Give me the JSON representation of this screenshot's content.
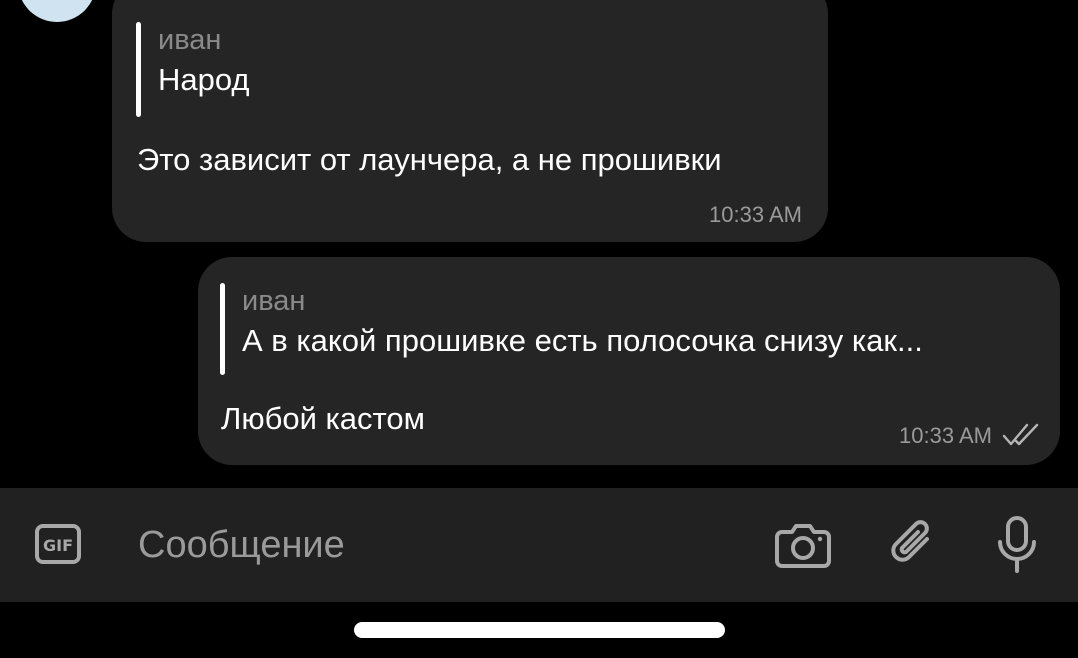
{
  "messages": [
    {
      "direction": "incoming",
      "reply": {
        "author": "иван",
        "text": "Народ"
      },
      "text": "Это зависит от лаунчера, а не прошивки",
      "time": "10:33 AM"
    },
    {
      "direction": "outgoing",
      "reply": {
        "author": "иван",
        "text": "А в какой прошивке есть полосочка снизу как..."
      },
      "text": "Любой кастом",
      "time": "10:33 AM",
      "status_icon": "double-check-icon"
    }
  ],
  "composer": {
    "placeholder": "Сообщение",
    "gif_label": "GIF",
    "icons": [
      "gif-icon",
      "camera-icon",
      "paperclip-icon",
      "microphone-icon"
    ]
  },
  "colors": {
    "background": "#000000",
    "bubble": "#252525",
    "input_bar": "#212121",
    "secondary_text": "#9a9a9a",
    "reply_author": "#8a8a8a"
  }
}
